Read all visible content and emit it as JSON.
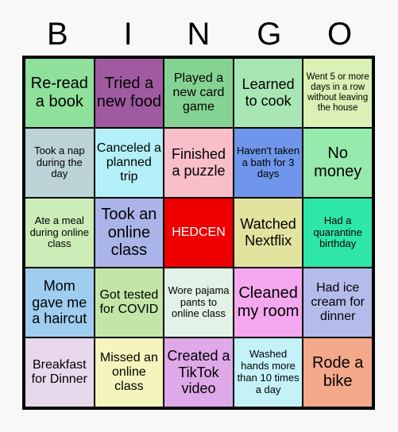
{
  "header": {
    "letters": [
      "B",
      "I",
      "N",
      "G",
      "O"
    ]
  },
  "colors": {
    "background": "#f8f8f8",
    "grid_border": "#000000",
    "free_space_bg": "#ee0000",
    "free_space_text": "#ffffff"
  },
  "grid": {
    "columns": 5,
    "rows": 5,
    "cells": [
      {
        "text": "Re-read a book",
        "bg": "#8fe09a",
        "size": "fs-xl"
      },
      {
        "text": "Tried a new food",
        "bg": "#a05aa0",
        "size": "fs-xl"
      },
      {
        "text": "Played a new card game",
        "bg": "#85d392",
        "size": "fs-md"
      },
      {
        "text": "Learned to cook",
        "bg": "#a8e6b4",
        "size": "fs-lg"
      },
      {
        "text": "Went 5 or more days in a row without leaving the house",
        "bg": "#daf0b4",
        "size": "fs-xs"
      },
      {
        "text": "Took a nap during the day",
        "bg": "#bcd4d8",
        "size": "fs-sm"
      },
      {
        "text": "Canceled a planned trip",
        "bg": "#b4f0f8",
        "size": "fs-md"
      },
      {
        "text": "Finished a puzzle",
        "bg": "#f9bfc9",
        "size": "fs-lg"
      },
      {
        "text": "Haven't taken a bath for 3 days",
        "bg": "#6f96ea",
        "size": "fs-sm"
      },
      {
        "text": "No money",
        "bg": "#96eaae",
        "size": "fs-xl"
      },
      {
        "text": "Ate a meal during online class",
        "bg": "#ccecb8",
        "size": "fs-sm"
      },
      {
        "text": "Took an online class",
        "bg": "#aab4e8",
        "size": "fs-xl"
      },
      {
        "text": "HEDCEN",
        "bg": "#ee0000",
        "size": "fs-md"
      },
      {
        "text": "Watched Nextflix",
        "bg": "#e3e3a0",
        "size": "fs-lg"
      },
      {
        "text": "Had a quarantine birthday",
        "bg": "#2ee6a8",
        "size": "fs-sm"
      },
      {
        "text": "Mom gave me a haircut",
        "bg": "#9fcdf0",
        "size": "fs-lg"
      },
      {
        "text": "Got tested for COVID",
        "bg": "#c3e6a8",
        "size": "fs-md"
      },
      {
        "text": "Wore pajama pants to online class",
        "bg": "#e2f2e6",
        "size": "fs-sm"
      },
      {
        "text": "Cleaned my room",
        "bg": "#f5a8f0",
        "size": "fs-xl"
      },
      {
        "text": "Had ice cream for dinner",
        "bg": "#b4bcec",
        "size": "fs-md"
      },
      {
        "text": "Breakfast for Dinner",
        "bg": "#e8d8ec",
        "size": "fs-md"
      },
      {
        "text": "Missed an online class",
        "bg": "#f4f4bc",
        "size": "fs-md"
      },
      {
        "text": "Created a TikTok video",
        "bg": "#dfa8e8",
        "size": "fs-lg"
      },
      {
        "text": "Washed hands more than 10 times a day",
        "bg": "#c4f2f8",
        "size": "fs-sm"
      },
      {
        "text": "Rode a bike",
        "bg": "#f4a98a",
        "size": "fs-xl"
      }
    ]
  }
}
